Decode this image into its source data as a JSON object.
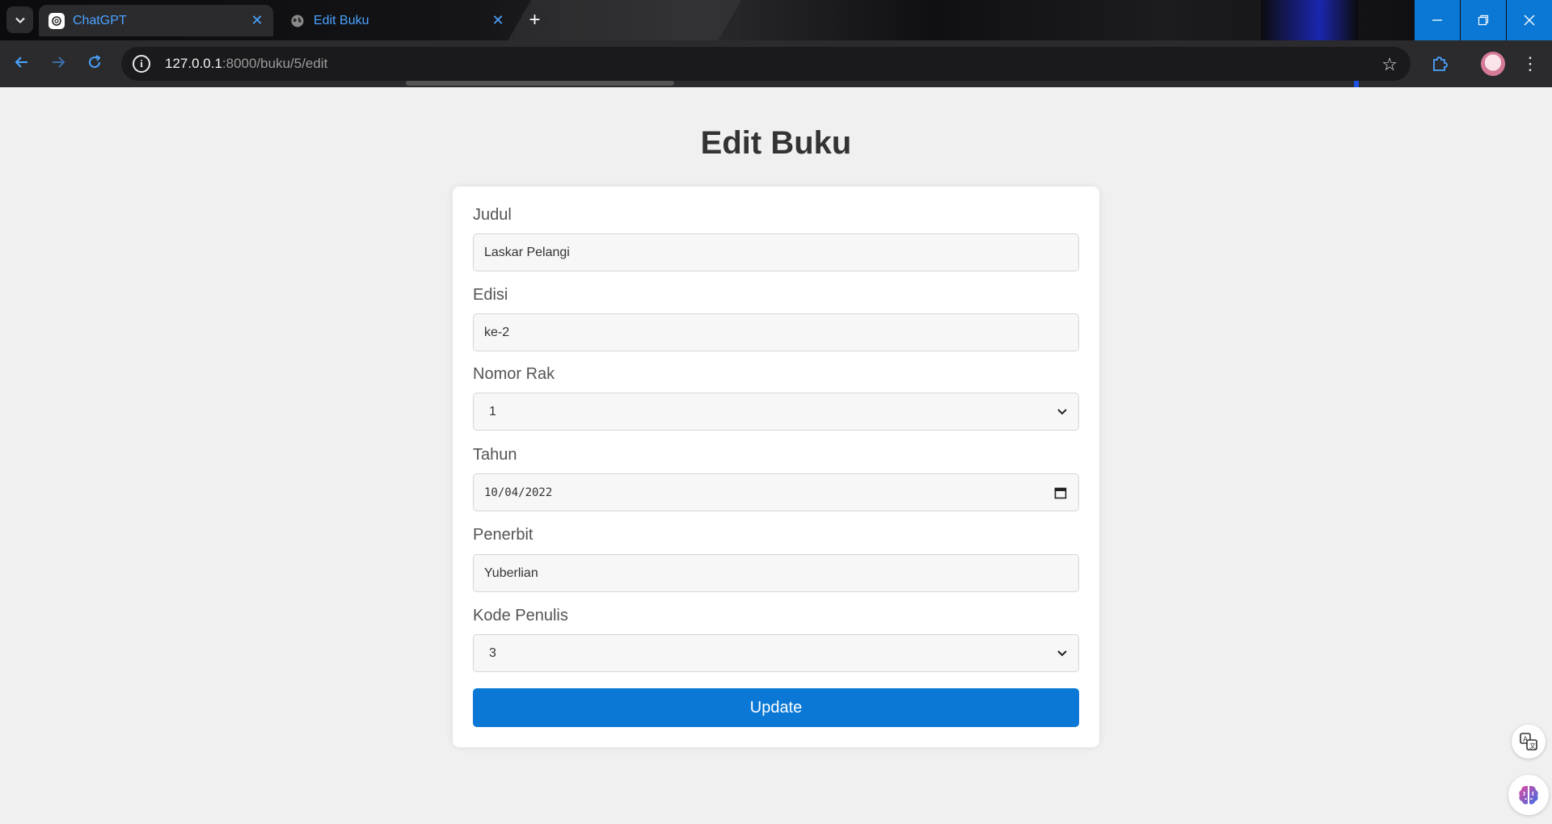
{
  "browser": {
    "tabs": [
      {
        "title": "ChatGPT",
        "active": true,
        "icon": "chatgpt-icon"
      },
      {
        "title": "Edit Buku",
        "active": false,
        "icon": "globe-icon"
      }
    ],
    "url_host": "127.0.0.1",
    "url_rest": ":8000/buku/5/edit"
  },
  "page": {
    "title": "Edit Buku",
    "fields": {
      "judul": {
        "label": "Judul",
        "value": "Laskar Pelangi"
      },
      "edisi": {
        "label": "Edisi",
        "value": "ke-2"
      },
      "nomor_rak": {
        "label": "Nomor Rak",
        "value": "1"
      },
      "tahun": {
        "label": "Tahun",
        "value": "10/04/2022"
      },
      "penerbit": {
        "label": "Penerbit",
        "value": "Yuberlian"
      },
      "kode_penulis": {
        "label": "Kode Penulis",
        "value": "3"
      }
    },
    "submit_label": "Update"
  },
  "colors": {
    "accent": "#0a78d4",
    "page_bg": "#f0f0f0",
    "chrome_bg": "#2b2b2e"
  }
}
